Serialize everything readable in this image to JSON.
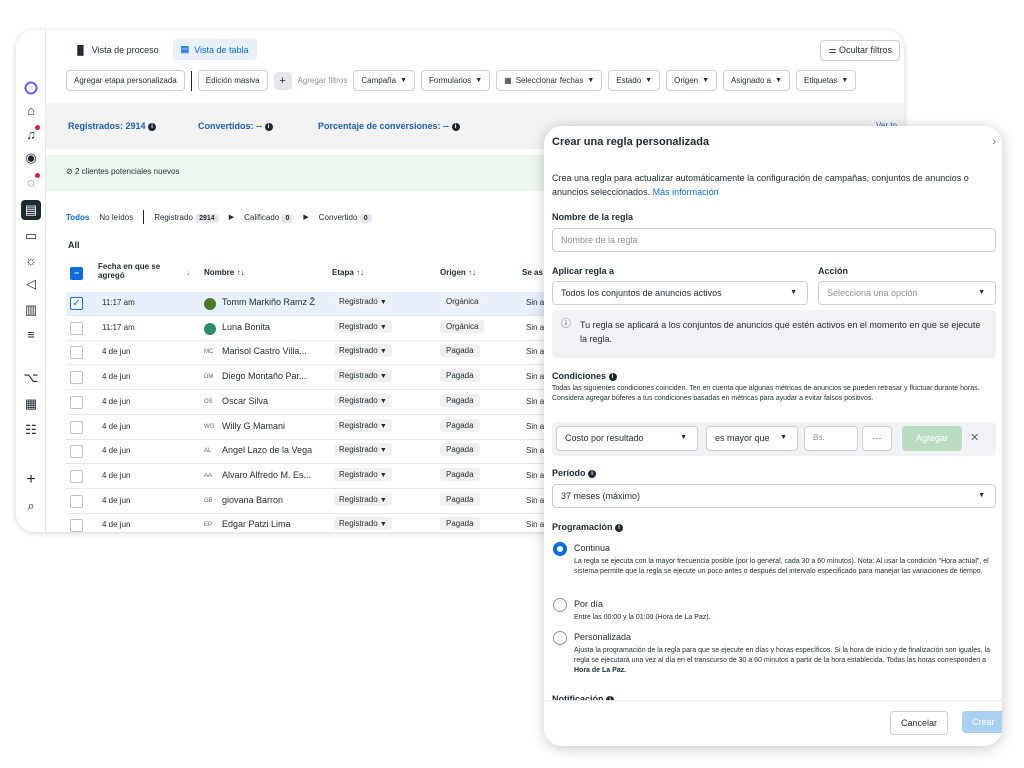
{
  "colors": {
    "accent": "#0a6de0",
    "metric_text": "#1d5fb4",
    "green_btn": "#b9dcc3",
    "alert_bg": "#eef7ee"
  },
  "header": {
    "view_process": "Vista de proceso",
    "view_table": "Vista de tabla",
    "hide_filters": "Ocultar filtros"
  },
  "toolbar": {
    "add_stage": "Agregar etapa personalizada",
    "bulk_edit": "Edición masiva",
    "add_filters": "Agregar filtros",
    "campaign": "Campaña",
    "forms": "Formularios",
    "select_dates": "Seleccionar fechas",
    "status": "Estado",
    "origin": "Origen",
    "assigned": "Asignado a",
    "tags": "Etiquetas"
  },
  "metrics": {
    "registered": "Registrados: 2914",
    "converted": "Convertidos: --",
    "conversion_rate": "Porcentaje de conversiones: --",
    "more": "Ver to"
  },
  "notice": "2 clientes potenciales nuevos",
  "filters": {
    "all": "Todos",
    "unread": "No leídos",
    "registered": "Registrado",
    "registered_count": "2914",
    "qualified": "Calificado",
    "qualified_count": "0",
    "converted": "Convertido",
    "converted_count": "0"
  },
  "table": {
    "section": "All",
    "headers": {
      "date": "Fecha en que se agregó",
      "name": "Nombre ↑↓",
      "stage": "Etapa ↑↓",
      "origin": "Origen ↑↓",
      "assigned": "Se as"
    },
    "rows": [
      {
        "date": "11:17 am",
        "initials": "",
        "name": "Tomm Markiño Ramz Ž",
        "stage": "Registrado",
        "origin": "Orgánica",
        "assigned": "Sin a",
        "checked": true
      },
      {
        "date": "11:17 am",
        "initials": "",
        "name": "Luna Bonita",
        "stage": "Registrado",
        "origin": "Orgánica",
        "assigned": "Sin a",
        "checked": false
      },
      {
        "date": "4 de jun",
        "initials": "MC",
        "name": "Marisol Castro Villa...",
        "stage": "Registrado",
        "origin": "Pagada",
        "assigned": "Sin a",
        "checked": false
      },
      {
        "date": "4 de jun",
        "initials": "DM",
        "name": "Diego Montaño Par...",
        "stage": "Registrado",
        "origin": "Pagada",
        "assigned": "Sin a",
        "checked": false
      },
      {
        "date": "4 de jun",
        "initials": "OS",
        "name": "Oscar Silva",
        "stage": "Registrado",
        "origin": "Pagada",
        "assigned": "Sin a",
        "checked": false
      },
      {
        "date": "4 de jun",
        "initials": "WG",
        "name": "Willy G Mamani",
        "stage": "Registrado",
        "origin": "Pagada",
        "assigned": "Sin a",
        "checked": false
      },
      {
        "date": "4 de jun",
        "initials": "AL",
        "name": "Angel Lazo de la Vega",
        "stage": "Registrado",
        "origin": "Pagada",
        "assigned": "Sin a",
        "checked": false
      },
      {
        "date": "4 de jun",
        "initials": "AA",
        "name": "Alvaro Alfredo M. Es...",
        "stage": "Registrado",
        "origin": "Pagada",
        "assigned": "Sin a",
        "checked": false
      },
      {
        "date": "4 de jun",
        "initials": "GB",
        "name": "giovana Barron",
        "stage": "Registrado",
        "origin": "Pagada",
        "assigned": "Sin a",
        "checked": false
      },
      {
        "date": "4 de jun",
        "initials": "EP",
        "name": "Edgar Patzi Lima",
        "stage": "Registrado",
        "origin": "Pagada",
        "assigned": "Sin a",
        "checked": false
      }
    ]
  },
  "panel": {
    "title": "Crear una regla personalizada",
    "desc": "Crea una regla para actualizar automáticamente la configuración de campañas, conjuntos de anuncios o anuncios seleccionados.",
    "learn_more": "Más información",
    "rule_name_label": "Nombre de la regla",
    "rule_name_placeholder": "Nombre de la regla",
    "apply_label": "Aplicar regla a",
    "apply_value": "Todos los conjuntos de anuncios activos",
    "action_label": "Acción",
    "action_placeholder": "Selecciona una opción",
    "info": "Tu regla se aplicará a los conjuntos de anuncios que estén activos en el momento en que se ejecute la regla.",
    "conditions_label": "Condiciones",
    "conditions_desc": "Todas las siguientes condiciones coinciden. Ten en cuenta que algunas métricas de anuncios se pueden retrasar y fluctuar durante horas. Considera agregar búferes a tus condiciones basadas en métricas para ayudar a evitar falsos positivos.",
    "cond_metric": "Costo por resultado",
    "cond_operator": "es mayor que",
    "cond_value_placeholder": "Bs.",
    "cond_more": "···",
    "cond_add": "Agregar",
    "cond_remove": "✕",
    "period_label": "Período",
    "period_value": "37 meses (máximo)",
    "schedule_label": "Programación",
    "options": [
      {
        "title": "Continua",
        "desc": "La regla se ejecuta con la mayor frecuencia posible (por lo general, cada 30 a 60 minutos). Nota: Al usar la condición \"Hora actual\", el sistema permite que la regla se ejecute un poco antes o después del intervalo especificado para manejar las variaciones de tiempo."
      },
      {
        "title": "Por día",
        "desc": "Entre las 00:00 y la 01:00 (Hora de La Paz)."
      },
      {
        "title": "Personalizada",
        "desc": "Ajusta la programación de la regla para que se ejecute en días y horas específicos. Si la hora de inicio y de finalización son iguales, la regla se ejecutará una vez al día en el transcurso de 30 a 60 minutos a partir de la hora establecida. Todas las horas corresponden a",
        "desc_bold": "Hora de La Paz."
      }
    ],
    "notification_label": "Notificación",
    "cancel": "Cancelar",
    "create": "Crear"
  }
}
